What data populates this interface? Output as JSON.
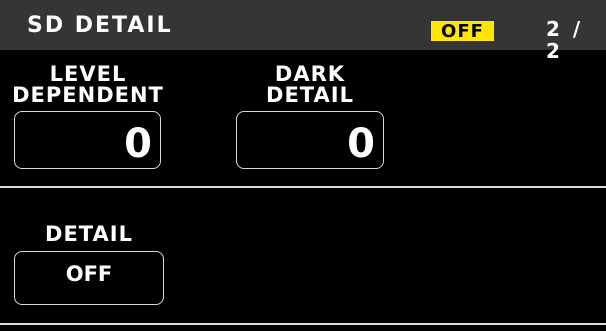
{
  "header": {
    "title": "SD DETAIL",
    "status": "OFF",
    "page": "2 / 2",
    "status_color": "#ffe600"
  },
  "params": {
    "level_dependent": {
      "label_line1": "LEVEL",
      "label_line2": "DEPENDENT",
      "value": "0"
    },
    "dark_detail": {
      "label_line1": "DARK",
      "label_line2": "DETAIL",
      "value": "0"
    },
    "detail": {
      "label": "DETAIL",
      "value": "OFF"
    }
  }
}
